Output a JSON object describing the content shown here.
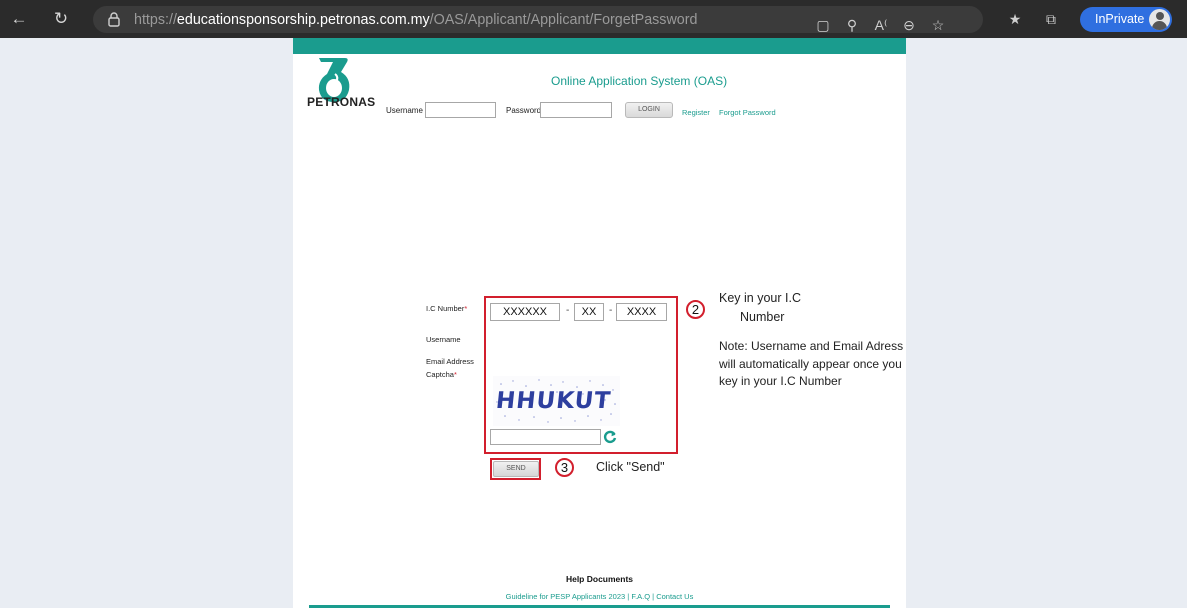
{
  "browser": {
    "url_scheme": "https://",
    "url_host": "educationsponsorship.petronas.com.my",
    "url_path": "/OAS/Applicant/Applicant/ForgetPassword",
    "inprivate_label": "InPrivate",
    "icons": [
      "back-icon",
      "refresh-icon",
      "lock-icon",
      "shop-icon",
      "key-icon",
      "read-aloud-icon",
      "zoom-out-icon",
      "add-favorite-icon",
      "favorites-icon",
      "collections-icon"
    ]
  },
  "header": {
    "logo_text": "PETRONAS",
    "title": "Online Application System (OAS)",
    "username_label": "Username",
    "password_label": "Password",
    "username_value": "",
    "password_value": "",
    "login_label": "LOGIN",
    "register_label": "Register",
    "forgot_label": "Forgot Password"
  },
  "form": {
    "ic_label": "I.C Number",
    "username_label": "Username",
    "email_label": "Email Address",
    "captcha_label": "Captcha",
    "required_mark": "*",
    "ic_part1": "XXXXXX",
    "ic_part2": "XX",
    "ic_part3": "XXXX",
    "ic_separator": "-",
    "captcha_text": "HHUKUT",
    "captcha_value": "",
    "send_label": "SEND"
  },
  "annotations": {
    "step2_number": "2",
    "step2_line1": "Key in your I.C",
    "step2_line2": "Number",
    "note_line1": "Note: Username and Email Adress",
    "note_line2": "will automatically appear once you",
    "note_line3": "key in your I.C Number",
    "step3_number": "3",
    "step3_text": "Click \"Send\""
  },
  "footer": {
    "help_title": "Help Documents",
    "link_guideline": "Guideline for PESP Applicants 2023",
    "separator": " | ",
    "link_faq": "F.A.Q",
    "link_contact": "Contact Us"
  },
  "colors": {
    "teal": "#1a9c8e",
    "annotation_red": "#d21f2d",
    "browser_dark": "#2b2b2b",
    "inprivate_blue": "#2f6fe0"
  }
}
